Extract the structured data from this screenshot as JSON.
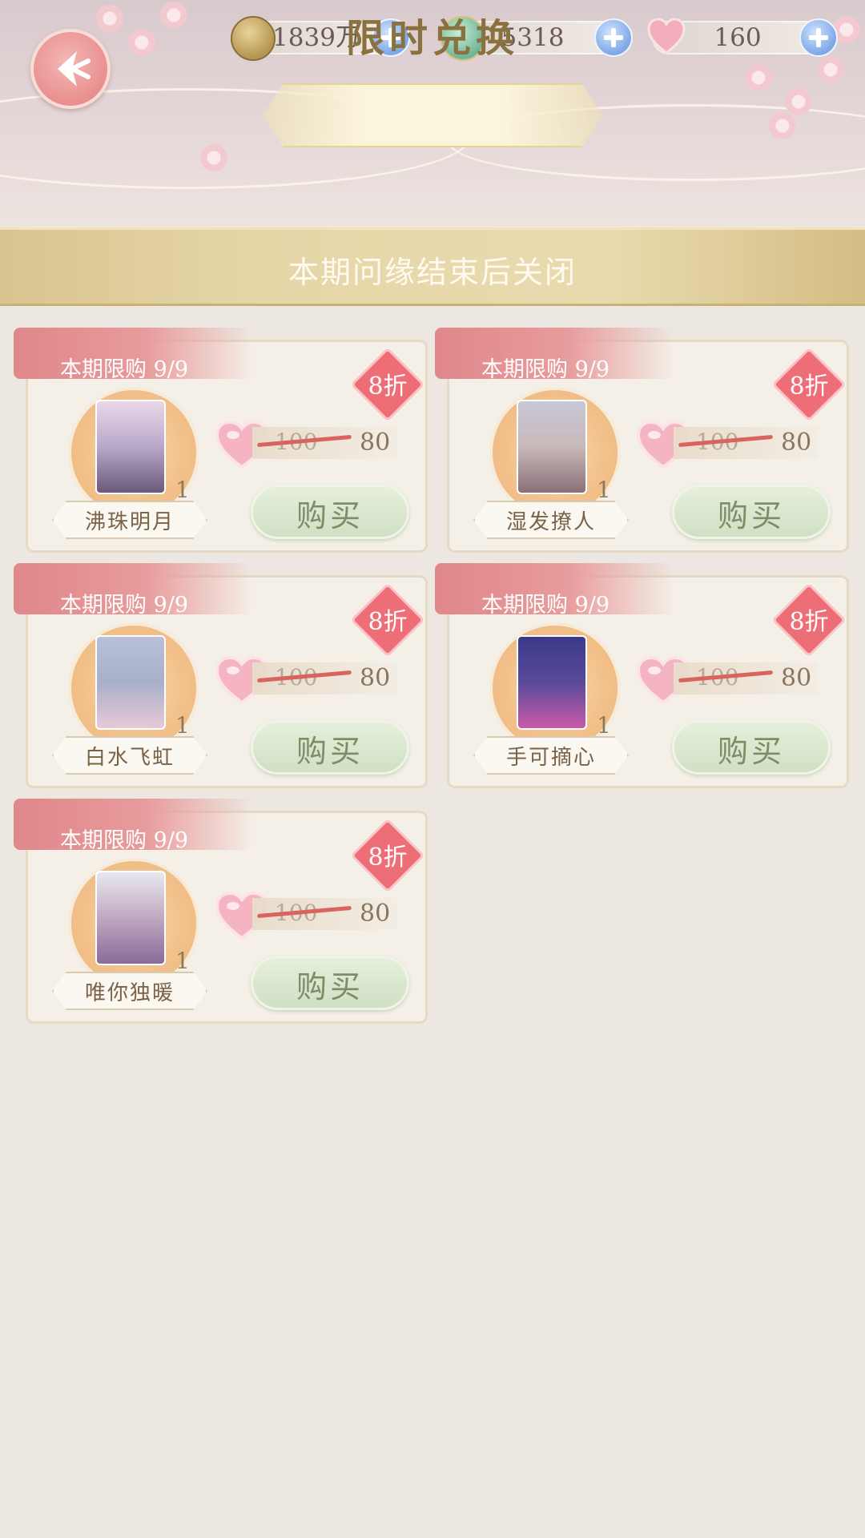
{
  "header": {
    "title": "限时兑换",
    "currencies": [
      {
        "icon": "paw-coin-icon",
        "value": "1839万"
      },
      {
        "icon": "jade-gem-icon",
        "value": "5318"
      },
      {
        "icon": "heart-icon",
        "value": "160"
      }
    ]
  },
  "banner": {
    "text": "本期问缘结束后关闭"
  },
  "items": [
    {
      "limit": "本期限购 9/9",
      "discount": "8折",
      "name": "沸珠明月",
      "qty": "1",
      "old_price": "100",
      "new_price": "80",
      "buy_label": "购买",
      "art": "#b8a8c8"
    },
    {
      "limit": "本期限购 9/9",
      "discount": "8折",
      "name": "湿发撩人",
      "qty": "1",
      "old_price": "100",
      "new_price": "80",
      "buy_label": "购买",
      "art": "#c8b8b8"
    },
    {
      "limit": "本期限购 9/9",
      "discount": "8折",
      "name": "白水飞虹",
      "qty": "1",
      "old_price": "100",
      "new_price": "80",
      "buy_label": "购买",
      "art": "#a8b0c8"
    },
    {
      "limit": "本期限购 9/9",
      "discount": "8折",
      "name": "手可摘心",
      "qty": "1",
      "old_price": "100",
      "new_price": "80",
      "buy_label": "购买",
      "art": "#5a4a9a"
    },
    {
      "limit": "本期限购 9/9",
      "discount": "8折",
      "name": "唯你独暖",
      "qty": "1",
      "old_price": "100",
      "new_price": "80",
      "buy_label": "购买",
      "art": "#c0a8c0"
    }
  ]
}
